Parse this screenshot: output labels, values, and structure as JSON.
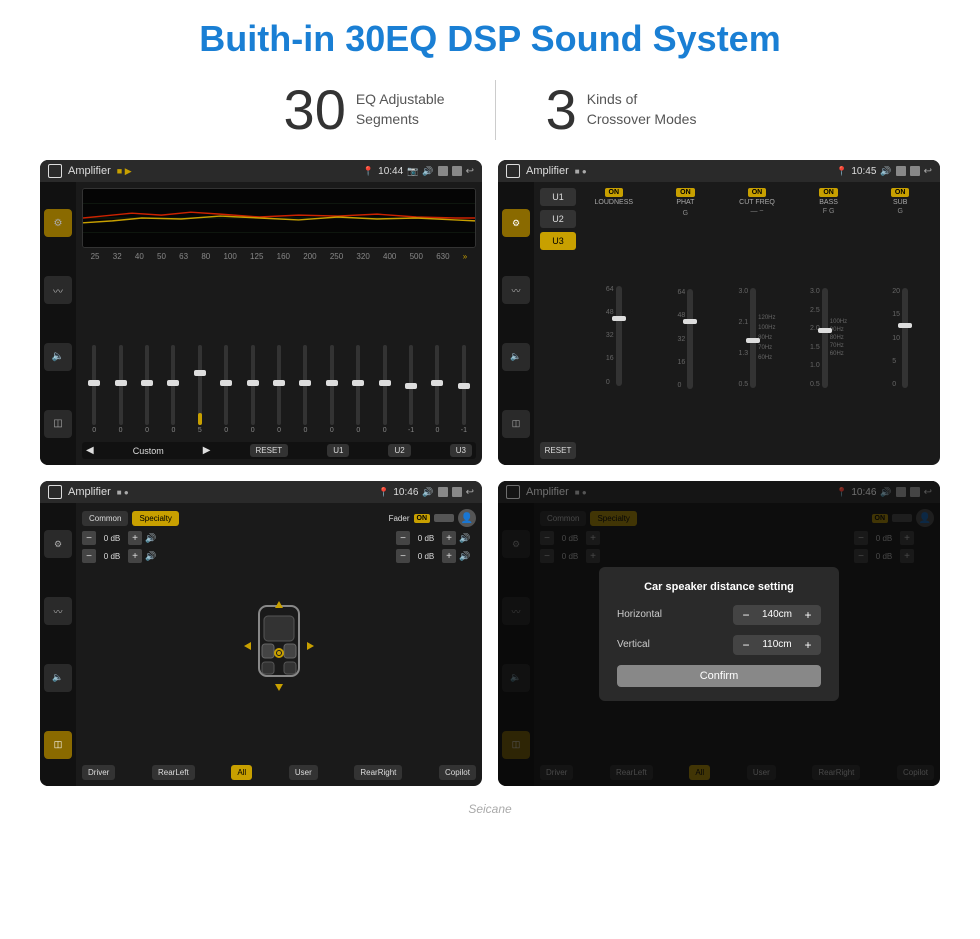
{
  "title": "Buith-in 30EQ DSP Sound System",
  "stats": [
    {
      "number": "30",
      "text": "EQ Adjustable\nSegments"
    },
    {
      "number": "3",
      "text": "Kinds of\nCrossover Modes"
    }
  ],
  "screens": {
    "eq1": {
      "status": {
        "app": "Amplifier",
        "time": "10:44"
      },
      "frequencies": [
        "25",
        "32",
        "40",
        "50",
        "63",
        "80",
        "100",
        "125",
        "160",
        "200",
        "250",
        "320",
        "400",
        "500",
        "630"
      ],
      "values": [
        "0",
        "0",
        "0",
        "0",
        "5",
        "0",
        "0",
        "0",
        "0",
        "0",
        "0",
        "0",
        "-1",
        "0",
        "-1"
      ],
      "bottomBtns": [
        "Custom",
        "RESET",
        "U1",
        "U2",
        "U3"
      ]
    },
    "crossover": {
      "status": {
        "app": "Amplifier",
        "time": "10:45"
      },
      "presets": [
        "U1",
        "U2",
        "U3"
      ],
      "channels": [
        "LOUDNESS",
        "PHAT",
        "CUT FREQ",
        "BASS",
        "SUB"
      ],
      "resetLabel": "RESET"
    },
    "speaker1": {
      "status": {
        "app": "Amplifier",
        "time": "10:46"
      },
      "modes": [
        "Common",
        "Specialty"
      ],
      "faderLabel": "Fader",
      "faderOn": "ON",
      "zones": [
        "Driver",
        "RearLeft",
        "All",
        "User",
        "RearRight",
        "Copilot"
      ],
      "volValues": [
        "0 dB",
        "0 dB",
        "0 dB",
        "0 dB"
      ]
    },
    "speaker2": {
      "status": {
        "app": "Amplifier",
        "time": "10:46"
      },
      "modes": [
        "Common",
        "Specialty"
      ],
      "faderOn": "ON",
      "dialog": {
        "title": "Car speaker distance setting",
        "horizontal": {
          "label": "Horizontal",
          "value": "140cm"
        },
        "vertical": {
          "label": "Vertical",
          "value": "110cm"
        },
        "confirmBtn": "Confirm"
      },
      "zones": [
        "Driver",
        "RearLeft",
        "All",
        "User",
        "RearRight",
        "Copilot"
      ],
      "volValues": [
        "0 dB",
        "0 dB"
      ]
    }
  },
  "watermark": "Seicane"
}
